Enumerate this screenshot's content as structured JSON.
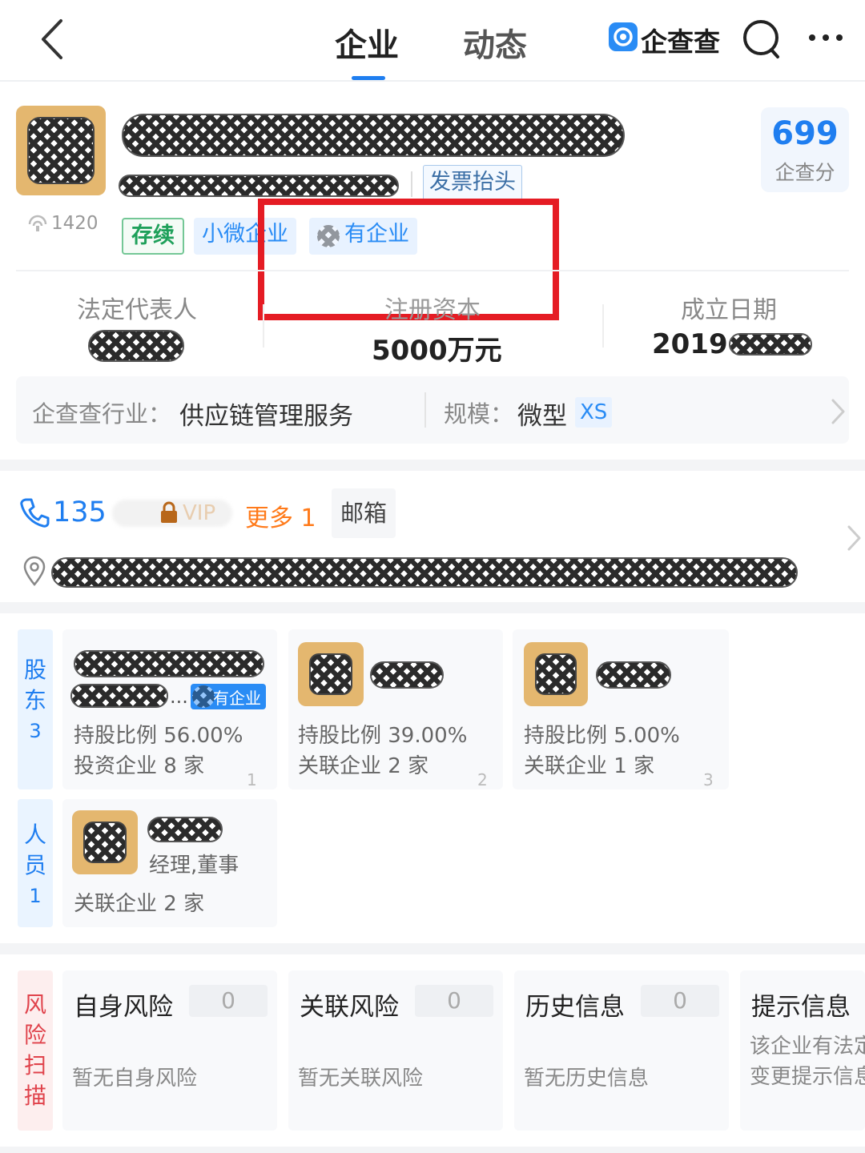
{
  "header": {
    "tabs": [
      {
        "label": "企业",
        "active": true
      },
      {
        "label": "动态",
        "active": false
      }
    ],
    "brand": "企查查",
    "colors": {
      "accent": "#1f7ef0",
      "brand_blue": "#2a8cf5",
      "highlight_red": "#e51c24"
    }
  },
  "company": {
    "invoice_button": "发票抬头",
    "views": "1420",
    "score": {
      "value": "699",
      "label": "企查分"
    },
    "tags": [
      "存续",
      "小微企业",
      "有企业"
    ]
  },
  "info": {
    "legal_rep_label": "法定代表人",
    "capital_label": "注册资本",
    "capital_value": "5000万元",
    "founded_label": "成立日期",
    "founded_value": "2019-"
  },
  "industry": {
    "label": "企查查行业：",
    "value": "供应链管理服务",
    "scale_label": "规模：",
    "scale_value": "微型",
    "scale_badge": "XS"
  },
  "contact": {
    "phone": "135",
    "vip": "VIP",
    "more": "更多 1",
    "email": "邮箱"
  },
  "shareholders": {
    "side_label": "股东",
    "count": "3",
    "items": [
      {
        "tag": "有企业",
        "ratio": "持股比例 56.00%",
        "related": "投资企业 8 家",
        "index": "1"
      },
      {
        "ratio": "持股比例 39.00%",
        "related": "关联企业 2 家",
        "index": "2"
      },
      {
        "ratio": "持股比例 5.00%",
        "related": "关联企业 1 家",
        "index": "3"
      }
    ]
  },
  "staff": {
    "side_label": "人员",
    "count": "1",
    "items": [
      {
        "role": "经理,董事",
        "related": "关联企业 2 家"
      }
    ]
  },
  "risk": {
    "side_label": "风险扫描",
    "cards": [
      {
        "title": "自身风险",
        "count": "0",
        "desc": "暂无自身风险"
      },
      {
        "title": "关联风险",
        "count": "0",
        "desc": "暂无关联风险"
      },
      {
        "title": "历史信息",
        "count": "0",
        "desc": "暂无历史信息"
      },
      {
        "title": "提示信息",
        "desc_line1": "该企业有法定",
        "desc_line2": "变更提示信息"
      }
    ]
  }
}
